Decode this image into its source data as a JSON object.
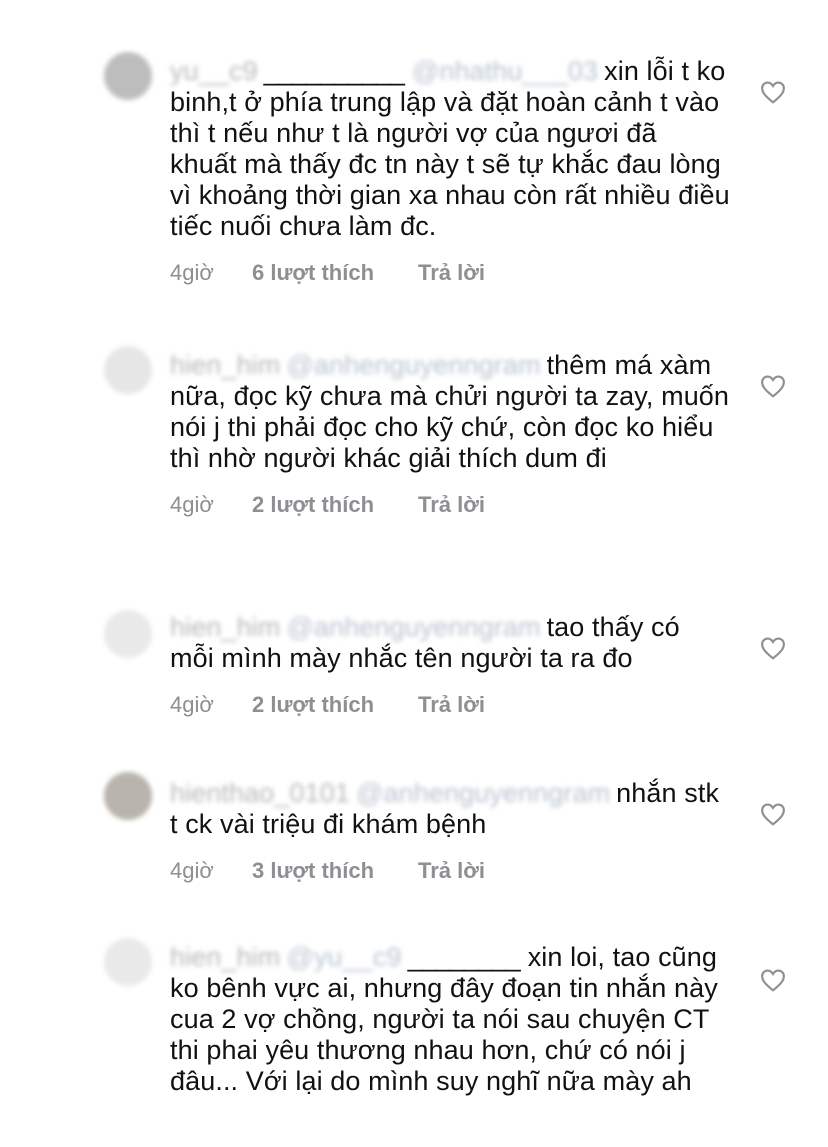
{
  "comments": [
    {
      "username": "yu__c9",
      "underline": "__________",
      "mention": "@nhathu___03",
      "text": "xin lỗi t ko binh,t ở phía trung lập và đặt hoàn cảnh t vào thì t  nếu như t là người vợ của ngươi đã khuất mà thấy đc tn này t sẽ tự khắc đau lòng vì khoảng thời gian xa nhau còn rất nhiều điều tiếc nuối chưa làm đc.",
      "time": "4giờ",
      "likes": "6 lượt thích",
      "reply": "Trả lời",
      "avatar_color": "#bdbdbd"
    },
    {
      "username": "hien_him",
      "underline": "",
      "mention": "@anhenguyenngram",
      "text": "thêm má xàm nữa, đọc kỹ chưa mà chửi người ta zay, muốn nói j thi phải đọc cho kỹ chứ, còn đọc ko hiểu thì nhờ người khác giải thích dum đi",
      "time": "4giờ",
      "likes": "2 lượt thích",
      "reply": "Trả lời",
      "avatar_color": "#e6e6e6"
    },
    {
      "username": "hien_him",
      "underline": "",
      "mention": "@anhenguyenngram",
      "text": "tao thấy có mỗi mình mày nhắc tên người ta ra đo",
      "time": "4giờ",
      "likes": "2 lượt thích",
      "reply": "Trả lời",
      "avatar_color": "#e9e9e9"
    },
    {
      "username": "hienthao_0101",
      "underline": "",
      "mention": "@anhenguyenngram",
      "text": "nhắn stk t ck vài triệu đi khám bệnh",
      "time": "4giờ",
      "likes": "3 lượt thích",
      "reply": "Trả lời",
      "avatar_color": "#b8b3ab"
    },
    {
      "username": "hien_him",
      "underline": "",
      "mention": "@yu__c9",
      "underline2": "________",
      "text": "xin loi, tao cũng ko bênh vực ai, nhưng đây đoạn tin nhắn này cua 2 vợ chồng, người ta nói sau chuyện CT thi phai yêu thương nhau hơn, chứ có nói j đâu... Với lại do mình suy nghĩ nữa mày ah",
      "time": "",
      "likes": "",
      "reply": "",
      "avatar_color": "#e9e9e9"
    }
  ]
}
